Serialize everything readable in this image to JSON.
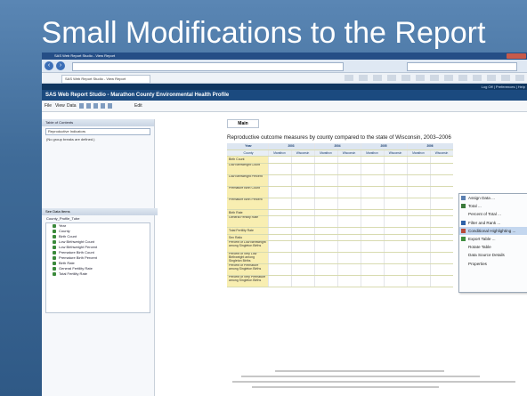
{
  "slide": {
    "title": "Small Modifications to the Report"
  },
  "browser": {
    "window_title": "SAS Web Report Studio - View Report",
    "url": "",
    "tab_label": "SAS Web Report Studio - View Report",
    "nav_right": "Log Off | Preferences | Help"
  },
  "app": {
    "title": "SAS Web Report Studio - Marathon County Environmental Health Profile",
    "menu": {
      "file": "File",
      "view": "View",
      "data": "Data",
      "edit": "Edit"
    },
    "main_tab": "Main"
  },
  "left": {
    "toc_header": "Table of Contents",
    "toc_select": "Reproductive Indicators",
    "toc_note": "(No group breaks are defined.)",
    "data_header": "See Data Items",
    "data_source": "County_Profile_Tube",
    "data_items": [
      "Year",
      "County",
      "Birth Count",
      "Low Birthweight Count",
      "Low Birthweight Percent",
      "Premature Birth Count",
      "Premature Birth Percent",
      "Birth Rate",
      "General Fertility Rate",
      "Total Fertility Rate"
    ]
  },
  "report": {
    "title": "Reproductive outcome measures by county compared to the state of Wisconsin, 2003–2006",
    "corner_year": "Year",
    "corner_county": "County",
    "years": [
      "2003",
      "2004",
      "2005",
      "2006"
    ],
    "subcols": [
      "Marathon",
      "Wisconsin"
    ],
    "rows": [
      {
        "label": "Birth Count",
        "tall": false
      },
      {
        "label": "Low Birthweight Count",
        "tall": true
      },
      {
        "label": "Low Birthweight Percent",
        "tall": true
      },
      {
        "label": "Premature Birth Count",
        "tall": true
      },
      {
        "label": "Premature Birth Percent",
        "tall": true
      },
      {
        "label": "Birth Rate",
        "tall": false
      },
      {
        "label": "General Fertility Rate",
        "tall": true
      },
      {
        "label": "Total Fertility Rate",
        "tall": false
      },
      {
        "label": "Sex Ratio",
        "tall": false
      },
      {
        "label": "Percent of Low Birthweight among Singleton Births",
        "tall": true
      },
      {
        "label": "Percent of Very Low Birthweight among Singleton Births",
        "tall": true
      },
      {
        "label": "Percent of Premature among Singleton Births",
        "tall": true
      },
      {
        "label": "Percent of Very Premature among Singleton Births",
        "tall": true
      }
    ]
  },
  "context_menu": {
    "items": [
      {
        "label": "Assign Data ...",
        "icon": "assign-data-icon",
        "highlighted": false
      },
      {
        "label": "Total ...",
        "icon": "total-icon",
        "highlighted": false
      },
      {
        "label": "Percent of Total ...",
        "icon": "",
        "highlighted": false
      },
      {
        "label": "Filter and Rank ...",
        "icon": "filter-icon",
        "highlighted": false
      },
      {
        "label": "Conditional Highlighting ...",
        "icon": "highlight-icon",
        "highlighted": true
      },
      {
        "label": "Export Table ...",
        "icon": "export-icon",
        "highlighted": false
      },
      {
        "label": "Rotate Table",
        "icon": "",
        "highlighted": false
      },
      {
        "label": "Data Source Details",
        "icon": "",
        "highlighted": false
      },
      {
        "label": "Properties",
        "icon": "",
        "highlighted": false
      }
    ]
  },
  "colors": {
    "header_cell": "#dde6f1",
    "row_label": "#f8eeb1",
    "highlight": "#c4d7ef",
    "sas_nav": "#10365f"
  }
}
